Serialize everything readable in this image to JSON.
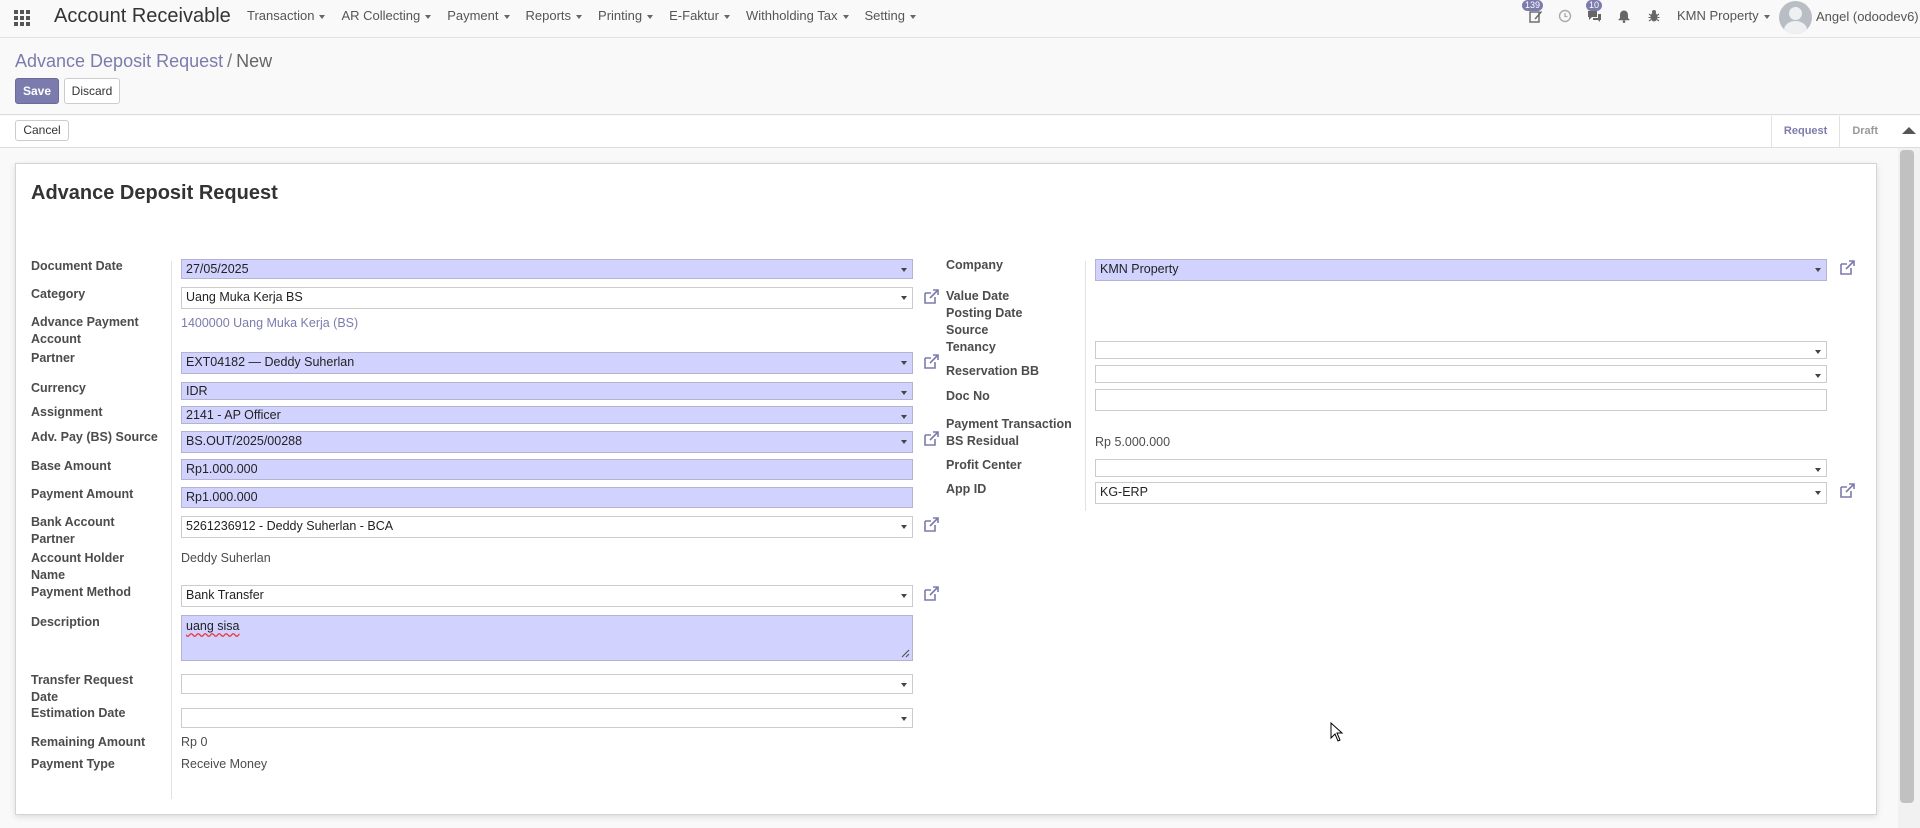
{
  "app": {
    "title": "Account Receivable"
  },
  "menu": [
    "Transaction",
    "AR Collecting",
    "Payment",
    "Reports",
    "Printing",
    "E-Faktur",
    "Withholding Tax",
    "Setting"
  ],
  "systray": {
    "activity_count": "139",
    "messages_count": "10",
    "company": "KMN Property",
    "user": "Angel (odoodev6)"
  },
  "breadcrumb": {
    "parent": "Advance Deposit Request",
    "separator": "/",
    "current": "New"
  },
  "buttons": {
    "save": "Save",
    "discard": "Discard",
    "cancel": "Cancel"
  },
  "stages": [
    "Request",
    "Draft"
  ],
  "form": {
    "title": "Advance Deposit Request",
    "left": {
      "document_date": {
        "label": "Document Date",
        "value": "27/05/2025"
      },
      "category": {
        "label": "Category",
        "value": "Uang Muka Kerja BS"
      },
      "adv_payment_account": {
        "label": "Advance Payment Account",
        "value": "1400000 Uang Muka Kerja (BS)"
      },
      "partner": {
        "label": "Partner",
        "value": "EXT04182 — Deddy Suherlan"
      },
      "currency": {
        "label": "Currency",
        "value": "IDR"
      },
      "assignment": {
        "label": "Assignment",
        "value": "2141 - AP Officer"
      },
      "adv_pay_source": {
        "label": "Adv. Pay (BS) Source",
        "value": "BS.OUT/2025/00288"
      },
      "base_amount": {
        "label": "Base Amount",
        "value": "Rp1.000.000"
      },
      "payment_amount": {
        "label": "Payment Amount",
        "value": "Rp1.000.000"
      },
      "bank_account_partner": {
        "label": "Bank Account Partner",
        "value": "5261236912 - Deddy Suherlan - BCA"
      },
      "account_holder_name": {
        "label": "Account Holder Name",
        "value": "Deddy Suherlan"
      },
      "payment_method": {
        "label": "Payment Method",
        "value": "Bank Transfer"
      },
      "description": {
        "label": "Description",
        "value": "uang sisa"
      },
      "transfer_request_date": {
        "label": "Transfer Request Date",
        "value": ""
      },
      "estimation_date": {
        "label": "Estimation Date",
        "value": ""
      },
      "remaining_amount": {
        "label": "Remaining Amount",
        "value": "Rp 0"
      },
      "payment_type": {
        "label": "Payment Type",
        "value": "Receive Money"
      }
    },
    "right": {
      "company": {
        "label": "Company",
        "value": "KMN Property"
      },
      "value_date": {
        "label": "Value Date",
        "value": ""
      },
      "posting_date": {
        "label": "Posting Date",
        "value": ""
      },
      "source": {
        "label": "Source",
        "value": ""
      },
      "tenancy": {
        "label": "Tenancy",
        "value": ""
      },
      "reservation_bb": {
        "label": "Reservation BB",
        "value": ""
      },
      "doc_no": {
        "label": "Doc No",
        "value": ""
      },
      "payment_transaction": {
        "label": "Payment Transaction",
        "value": ""
      },
      "bs_residual": {
        "label": "BS Residual",
        "value": "Rp 5.000.000"
      },
      "profit_center": {
        "label": "Profit Center",
        "value": ""
      },
      "app_id": {
        "label": "App ID",
        "value": "KG-ERP"
      }
    }
  },
  "colors": {
    "accent": "#7c7bad",
    "required_field": "#d2d2ff"
  }
}
